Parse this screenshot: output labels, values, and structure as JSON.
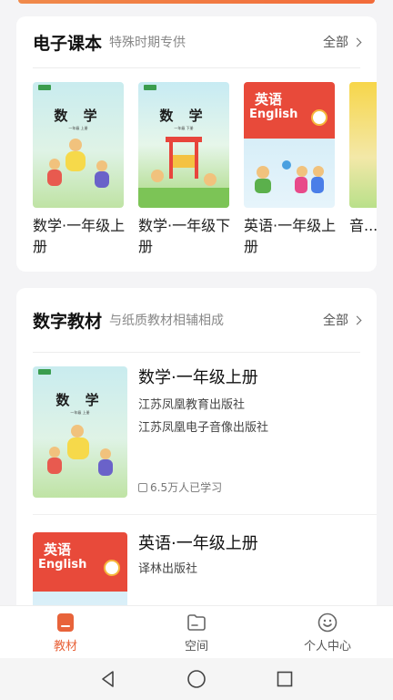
{
  "ebook": {
    "title": "电子课本",
    "subtitle": "特殊时期专供",
    "more": "全部",
    "books": [
      {
        "title": "数学·一年级上册",
        "cover_title": "数 学",
        "cover_sub": "一年级 上册"
      },
      {
        "title": "数学·一年级下册",
        "cover_title": "数 学",
        "cover_sub": "一年级 下册"
      },
      {
        "title": "英语·一年级上册",
        "cover_title": "英语",
        "cover_en": "English"
      },
      {
        "title": "音..."
      }
    ]
  },
  "digital": {
    "title": "数字教材",
    "subtitle": "与纸质教材相辅相成",
    "more": "全部",
    "items": [
      {
        "title": "数学·一年级上册",
        "pub1": "江苏凤凰教育出版社",
        "pub2": "江苏凤凰电子音像出版社",
        "learners": "6.5万人已学习",
        "cover_title": "数 学",
        "cover_sub": "一年级 上册"
      },
      {
        "title": "英语·一年级上册",
        "pub1": "译林出版社",
        "cover_title": "英语",
        "cover_en": "English"
      }
    ]
  },
  "tabs": [
    {
      "label": "教材",
      "icon": "book-icon",
      "active": true
    },
    {
      "label": "空间",
      "icon": "folder-icon",
      "active": false
    },
    {
      "label": "个人中心",
      "icon": "smiley-icon",
      "active": false
    }
  ],
  "colors": {
    "accent": "#e8633a",
    "background": "#f4f4f6"
  }
}
